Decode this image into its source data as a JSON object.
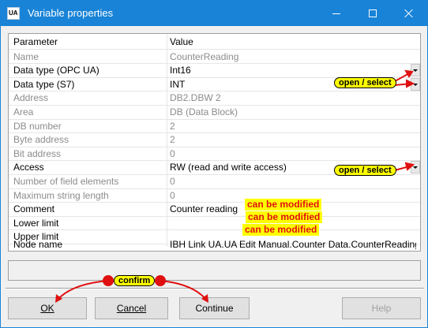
{
  "window": {
    "title": "Variable properties",
    "app_icon_text": "UA"
  },
  "grid": {
    "header": {
      "param": "Parameter",
      "value": "Value"
    },
    "rows": [
      {
        "param": "Name",
        "value": "CounterReading",
        "enabled": false
      },
      {
        "param": "Data type (OPC UA)",
        "value": "Int16",
        "enabled": true,
        "dropdown": true
      },
      {
        "param": "Data type (S7)",
        "value": "INT",
        "enabled": true,
        "dropdown": true
      },
      {
        "param": "Address",
        "value": "DB2.DBW 2",
        "enabled": false
      },
      {
        "param": "Area",
        "value": "DB (Data Block)",
        "enabled": false
      },
      {
        "param": "DB number",
        "value": "2",
        "enabled": false
      },
      {
        "param": "Byte address",
        "value": "2",
        "enabled": false
      },
      {
        "param": "Bit address",
        "value": "0",
        "enabled": false
      },
      {
        "param": "Access",
        "value": "RW (read and write access)",
        "enabled": true,
        "dropdown": true
      },
      {
        "param": "Number of field elements",
        "value": "0",
        "enabled": false
      },
      {
        "param": "Maximum string length",
        "value": "0",
        "enabled": false
      },
      {
        "param": "Comment",
        "value": "Counter reading",
        "enabled": true
      },
      {
        "param": "Lower limit",
        "value": "",
        "enabled": true
      },
      {
        "param": "Upper limit",
        "value": "",
        "enabled": true
      },
      {
        "param": "Node name",
        "value": "IBH Link UA.UA Edit Manual.Counter Data.CounterReading",
        "enabled": true
      }
    ]
  },
  "status_field": {
    "value": ""
  },
  "buttons": {
    "ok": "OK",
    "cancel": "Cancel",
    "continue": "Continue",
    "help": "Help"
  },
  "annotations": {
    "open_select": "open / select",
    "can_be_modified": "can be modified",
    "confirm": "confirm"
  },
  "colors": {
    "titlebar": "#1883d7",
    "callout_fill": "#ffff00",
    "callout_text_red": "#e01010",
    "annotation_arrow": "#e01010",
    "disabled_text": "#8c8c8c"
  }
}
